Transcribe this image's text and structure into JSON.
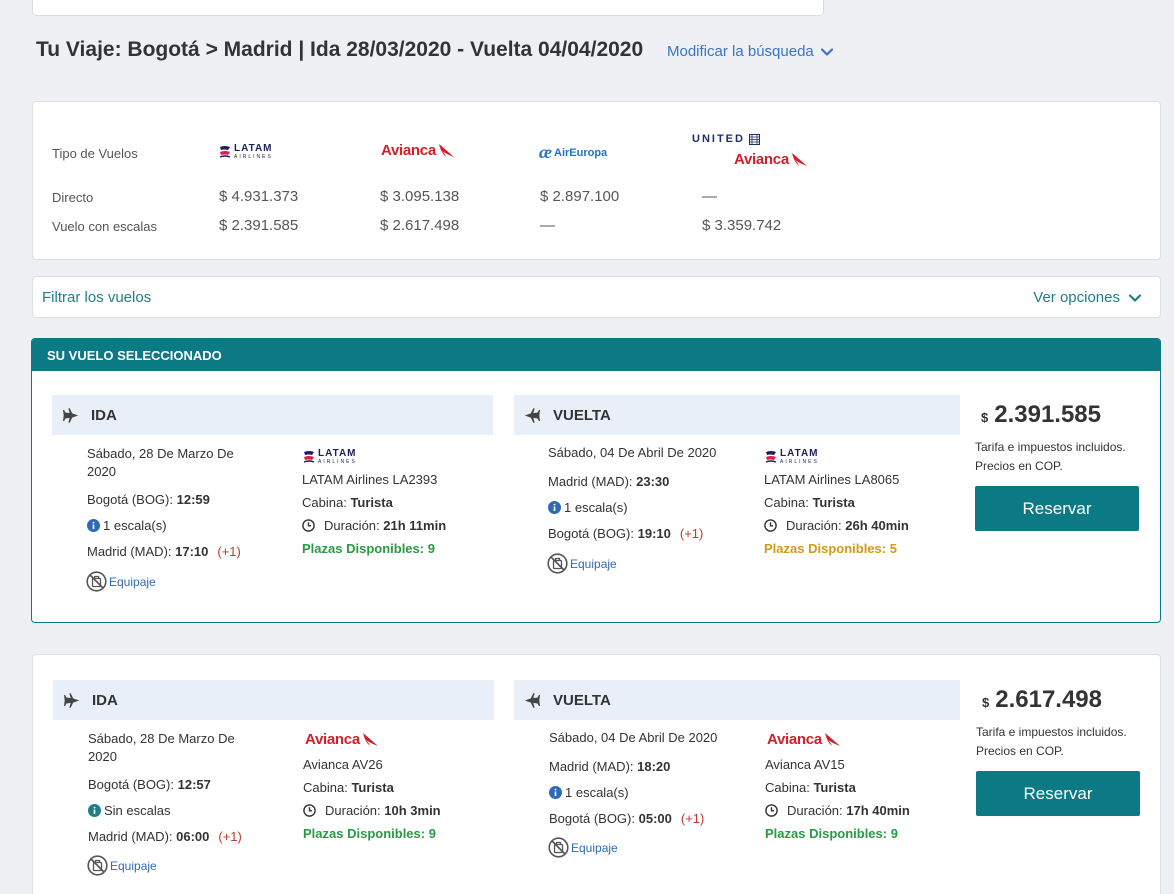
{
  "trip": {
    "title": "Tu Viaje: Bogotá > Madrid | Ida 28/03/2020 - Vuelta 04/04/2020",
    "modify_label": "Modificar la búsqueda"
  },
  "matrix": {
    "header_label": "Tipo de Vuelos",
    "row_direct": "Directo",
    "row_stops": "Vuelo con escalas",
    "airlines": [
      {
        "logo": "latam-logo",
        "text": "LATAM",
        "subtext": "AIRLINES",
        "direct": "$ 4.931.373",
        "stops": "$ 2.391.585"
      },
      {
        "logo": "avianca-logo",
        "text": "Avianca",
        "direct": "$ 3.095.138",
        "stops": "$ 2.617.498"
      },
      {
        "logo": "aireuropa-logo",
        "mark": "æ",
        "text": "AirEuropa",
        "direct": "$ 2.897.100",
        "stops": "—"
      },
      {
        "logo": "united-avianca-logo",
        "text": "UNITED",
        "text2": "Avianca",
        "direct": "—",
        "stops": "$ 3.359.742"
      }
    ]
  },
  "filter": {
    "title": "Filtrar los vuelos",
    "options_label": "Ver opciones"
  },
  "selected_banner": "SU VUELO SELECCIONADO",
  "offers": [
    {
      "ida": {
        "label": "IDA",
        "date": "Sábado, 28 De Marzo De 2020",
        "origin_label": "Bogotá (BOG):",
        "origin_time": "12:59",
        "stops": "1 escala(s)",
        "dest_label": "Madrid (MAD):",
        "dest_time": "17:10",
        "plus_day": "(+1)",
        "baggage": "Equipaje",
        "airline_logo": "latam-logo",
        "flight": "LATAM Airlines LA2393",
        "cabin_label": "Cabina:",
        "cabin": "Turista",
        "duration_label": "Duración:",
        "duration": "21h 11min",
        "seats": "Plazas Disponibles: 9"
      },
      "vuelta": {
        "label": "VUELTA",
        "date": "Sábado, 04 De Abril De 2020",
        "origin_label": "Madrid (MAD):",
        "origin_time": "23:30",
        "stops": "1 escala(s)",
        "dest_label": "Bogotá (BOG):",
        "dest_time": "19:10",
        "plus_day": "(+1)",
        "baggage": "Equipaje",
        "airline_logo": "latam-logo",
        "flight": "LATAM Airlines LA8065",
        "cabin_label": "Cabina:",
        "cabin": "Turista",
        "duration_label": "Duración:",
        "duration": "26h 40min",
        "seats": "Plazas Disponibles: 5"
      },
      "currency": "$",
      "price": "2.391.585",
      "note": "Tarifa e impuestos incluidos. Precios en COP.",
      "reserve_label": "Reservar"
    },
    {
      "ida": {
        "label": "IDA",
        "date": "Sábado, 28 De Marzo De 2020",
        "origin_label": "Bogotá (BOG):",
        "origin_time": "12:57",
        "stops": "Sin escalas",
        "dest_label": "Madrid (MAD):",
        "dest_time": "06:00",
        "plus_day": "(+1)",
        "baggage": "Equipaje",
        "airline_logo": "avianca-logo",
        "flight": "Avianca AV26",
        "cabin_label": "Cabina:",
        "cabin": "Turista",
        "duration_label": "Duración:",
        "duration": "10h 3min",
        "seats": "Plazas Disponibles: 9"
      },
      "vuelta": {
        "label": "VUELTA",
        "date": "Sábado, 04 De Abril De 2020",
        "origin_label": "Madrid (MAD):",
        "origin_time": "18:20",
        "stops": "1 escala(s)",
        "dest_label": "Bogotá (BOG):",
        "dest_time": "05:00",
        "plus_day": "(+1)",
        "baggage": "Equipaje",
        "airline_logo": "avianca-logo",
        "flight": "Avianca AV15",
        "cabin_label": "Cabina:",
        "cabin": "Turista",
        "duration_label": "Duración:",
        "duration": "17h 40min",
        "seats": "Plazas Disponibles: 9"
      },
      "currency": "$",
      "price": "2.617.498",
      "note": "Tarifa e impuestos incluidos. Precios en COP.",
      "reserve_label": "Reservar"
    }
  ],
  "colors": {
    "teal": "#0b7a84",
    "link_blue": "#3a73c9",
    "seats_green": "#2a9a43",
    "seats_orange": "#d39a17",
    "avianca_red": "#d0202a",
    "latam_navy": "#1b1f5c"
  }
}
